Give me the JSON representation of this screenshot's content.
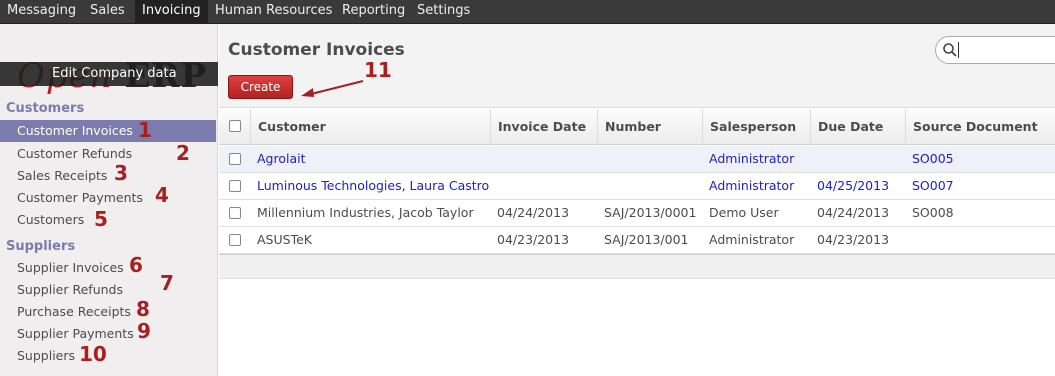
{
  "topmenu": [
    "Messaging",
    "Sales",
    "Invoicing",
    "Human Resources",
    "Reporting",
    "Settings"
  ],
  "topmenu_active": "Invoicing",
  "sidebar": {
    "edit_company": "Edit Company data",
    "logo_open": "Open",
    "logo_erp": "ERP",
    "customers_header": "Customers",
    "customers_items": [
      "Customer Invoices",
      "Customer Refunds",
      "Sales Receipts",
      "Customer Payments",
      "Customers"
    ],
    "suppliers_header": "Suppliers",
    "suppliers_items": [
      "Supplier Invoices",
      "Supplier Refunds",
      "Purchase Receipts",
      "Supplier Payments",
      "Suppliers"
    ],
    "annotations": [
      "1",
      "2",
      "3",
      "4",
      "5",
      "6",
      "7",
      "8",
      "9",
      "10"
    ]
  },
  "main": {
    "title": "Customer Invoices",
    "create_label": "Create",
    "annotation": "11",
    "search_value": ""
  },
  "table": {
    "columns": [
      "Customer",
      "Invoice Date",
      "Number",
      "Salesperson",
      "Due Date",
      "Source Document"
    ],
    "rows": [
      [
        "Agrolait",
        "",
        "",
        "Administrator",
        "",
        "SO005"
      ],
      [
        "Luminous Technologies, Laura Castro",
        "",
        "",
        "Administrator",
        "04/25/2013",
        "SO007"
      ],
      [
        "Millennium Industries, Jacob Taylor",
        "04/24/2013",
        "SAJ/2013/0001",
        "Demo User",
        "04/24/2013",
        "SO008"
      ],
      [
        "ASUSTeK",
        "04/23/2013",
        "SAJ/2013/001",
        "Administrator",
        "04/23/2013",
        ""
      ]
    ]
  },
  "colors": {
    "accent": "#7c7bad",
    "create": "#c22828",
    "annotation": "#a81f1f",
    "link": "#2222bb"
  }
}
